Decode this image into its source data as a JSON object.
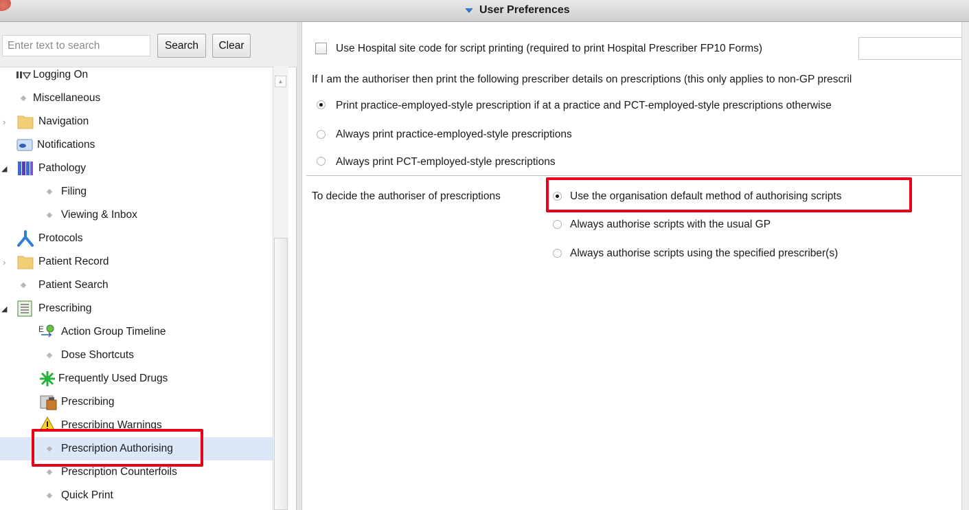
{
  "window": {
    "title": "User Preferences"
  },
  "search": {
    "placeholder": "Enter text to search",
    "search_label": "Search",
    "clear_label": "Clear"
  },
  "tree": {
    "items": [
      {
        "label": "Logging On",
        "icon": "logging-on-icon"
      },
      {
        "label": "Miscellaneous",
        "icon": "bullet-icon"
      },
      {
        "label": "Navigation",
        "icon": "folder-icon"
      },
      {
        "label": "Notifications",
        "icon": "notifications-icon"
      },
      {
        "label": "Pathology",
        "icon": "pathology-icon"
      },
      {
        "label": "Filing",
        "icon": "bullet-icon"
      },
      {
        "label": "Viewing & Inbox",
        "icon": "bullet-icon"
      },
      {
        "label": "Protocols",
        "icon": "protocols-icon"
      },
      {
        "label": "Patient Record",
        "icon": "folder-icon"
      },
      {
        "label": "Patient Search",
        "icon": "bullet-icon"
      },
      {
        "label": "Prescribing",
        "icon": "prescribing-icon"
      },
      {
        "label": "Action Group Timeline",
        "icon": "action-group-icon"
      },
      {
        "label": "Dose Shortcuts",
        "icon": "bullet-icon"
      },
      {
        "label": "Frequently Used Drugs",
        "icon": "asterisk-icon"
      },
      {
        "label": "Prescribing",
        "icon": "prescribing-settings-icon"
      },
      {
        "label": "Prescribing Warnings",
        "icon": "warning-icon"
      },
      {
        "label": "Prescription Authorising",
        "icon": "bullet-icon",
        "selected": true
      },
      {
        "label": "Prescription Counterfoils",
        "icon": "bullet-icon"
      },
      {
        "label": "Quick Print",
        "icon": "bullet-icon"
      }
    ]
  },
  "settings": {
    "hospital_site_code": {
      "label": "Use Hospital site code for script printing (required to print Hospital Prescriber FP10 Forms)",
      "checked": false,
      "value": ""
    },
    "prescriber_details_intro": "If I am the authoriser then print the following prescriber details on prescriptions (this only applies to non-GP prescril",
    "print_style_options": [
      {
        "label": "Print practice-employed-style prescription if at a practice and PCT-employed-style prescriptions otherwise",
        "checked": true
      },
      {
        "label": "Always print practice-employed-style prescriptions",
        "checked": false
      },
      {
        "label": "Always print PCT-employed-style prescriptions",
        "checked": false
      }
    ],
    "authoriser_label": "To decide the authoriser of prescriptions",
    "authoriser_options": [
      {
        "label": "Use the organisation default method of authorising scripts",
        "checked": true
      },
      {
        "label": "Always authorise scripts with the usual GP",
        "checked": false
      },
      {
        "label": "Always authorise scripts using the specified prescriber(s)",
        "checked": false
      }
    ]
  },
  "colors": {
    "highlight": "#e8001a",
    "selection": "#dce7f8"
  }
}
